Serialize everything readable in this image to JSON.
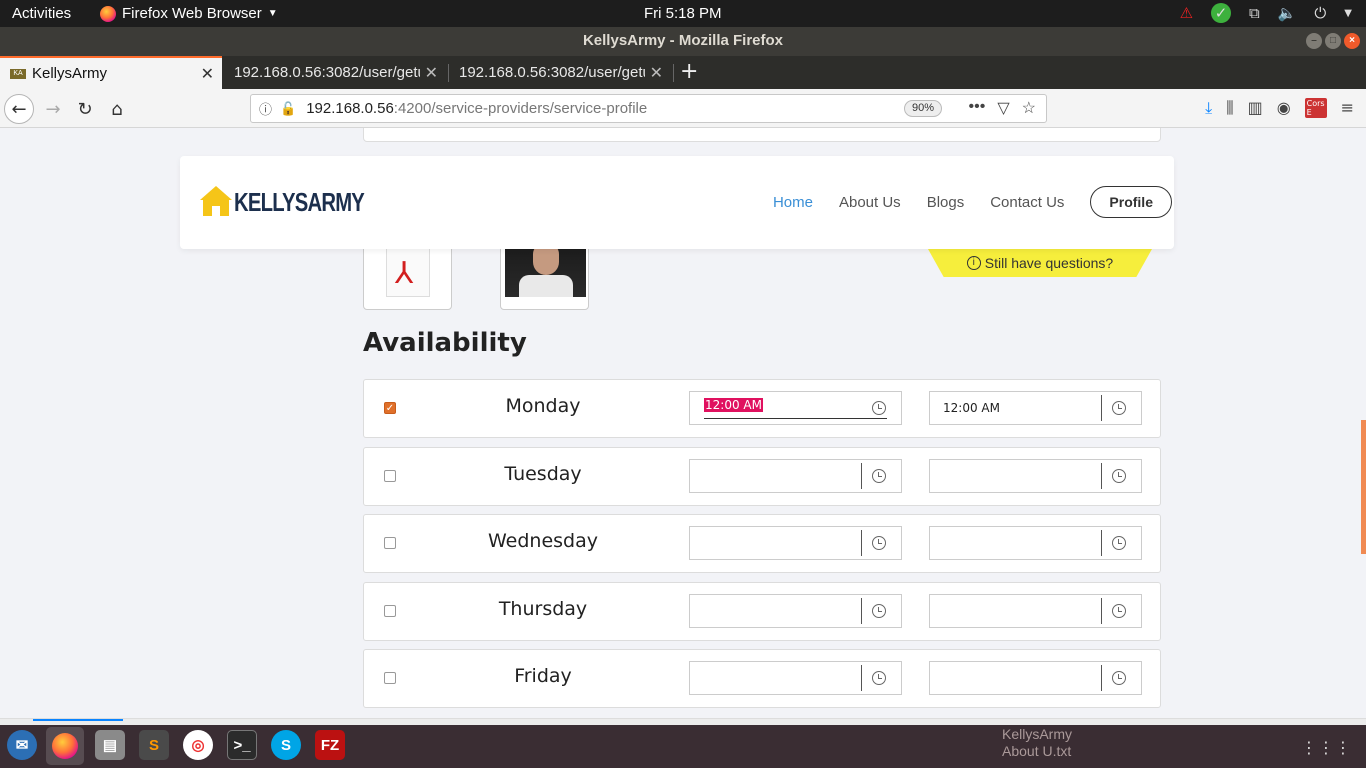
{
  "topbar": {
    "activities": "Activities",
    "app_name": "Firefox Web Browser",
    "clock": "Fri  5:18 PM"
  },
  "window": {
    "title": "KellysArmy - Mozilla Firefox"
  },
  "tabs": [
    {
      "label": "KellysArmy",
      "active": true
    },
    {
      "label": "192.168.0.56:3082/user/getu",
      "active": false
    },
    {
      "label": "192.168.0.56:3082/user/getu",
      "active": false
    }
  ],
  "urlbar": {
    "host": "192.168.0.56",
    "path": ":4200/service-providers/service-profile",
    "zoom": "90%"
  },
  "site": {
    "logo_text": "KELLYSARMY",
    "nav": [
      {
        "label": "Home",
        "active": true
      },
      {
        "label": "About Us",
        "active": false
      },
      {
        "label": "Blogs",
        "active": false
      },
      {
        "label": "Contact Us",
        "active": false
      }
    ],
    "profile_button": "Profile",
    "still_questions": "Still have questions?"
  },
  "availability": {
    "title": "Availability",
    "days": [
      {
        "day": "Monday",
        "checked": true,
        "from": "12:00 AM",
        "to": "12:00 AM"
      },
      {
        "day": "Tuesday",
        "checked": false,
        "from": "",
        "to": ""
      },
      {
        "day": "Wednesday",
        "checked": false,
        "from": "",
        "to": ""
      },
      {
        "day": "Thursday",
        "checked": false,
        "from": "",
        "to": ""
      },
      {
        "day": "Friday",
        "checked": false,
        "from": "",
        "to": ""
      }
    ]
  },
  "dock": {
    "note_line1": "KellysArmy",
    "note_line2": "About U.txt"
  },
  "colors": {
    "accent": "#e0702a",
    "nav_active": "#3a8fd6",
    "question_banner": "#f6ee3c",
    "selection": "#e0115f"
  }
}
